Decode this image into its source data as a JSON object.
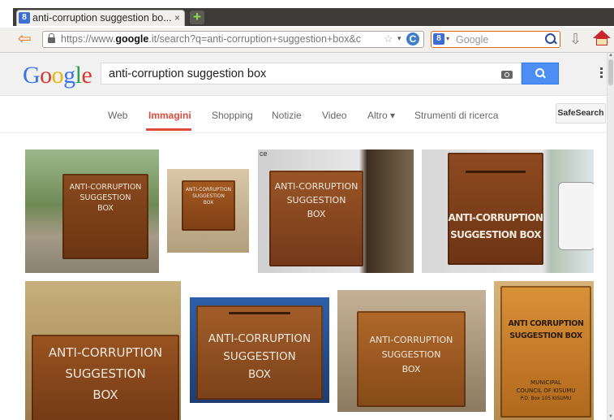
{
  "browser": {
    "tab": {
      "title": "anti-corruption suggestion bo...",
      "close": "×",
      "favicon": "8"
    },
    "new_tab": "+",
    "url": {
      "prefix": "https://www.",
      "domain": "google",
      "rest": ".it/search?q=anti-corruption+suggestion+box&c"
    },
    "search_engine_badge": "8",
    "search_placeholder": "Google",
    "back": "⇦",
    "star": "☆",
    "dropdown": "▾",
    "reload": "C",
    "download": "⇩"
  },
  "google": {
    "logo": [
      "G",
      "o",
      "o",
      "g",
      "l",
      "e"
    ],
    "query": "anti-corruption suggestion box",
    "nav": [
      {
        "label": "Web",
        "active": false
      },
      {
        "label": "Immagini",
        "active": true
      },
      {
        "label": "Shopping",
        "active": false
      },
      {
        "label": "Notizie",
        "active": false
      },
      {
        "label": "Video",
        "active": false
      },
      {
        "label": "Altro ▾",
        "active": false
      },
      {
        "label": "Strumenti di ricerca",
        "active": false
      }
    ],
    "safesearch": "SafeSearch"
  },
  "results": [
    {
      "lines": [
        "ANTI-CORRUPTION",
        "SUGGESTION",
        "BOX"
      ]
    },
    {
      "lines": [
        "ANTI-CORRUPTION",
        "SUGGESTION",
        "BOX"
      ]
    },
    {
      "lines": [
        "ANTI-CORRUPTION",
        "SUGGESTION",
        "BOX"
      ],
      "corner": "ce"
    },
    {
      "lines": [
        "ANTI-CORRUPTION",
        "SUGGESTION BOX"
      ]
    },
    {
      "lines": [
        "ANTI-CORRUPTION",
        "SUGGESTION",
        "BOX"
      ]
    },
    {
      "lines": [
        "ANTI-CORRUPTION",
        "SUGGESTION",
        "BOX"
      ]
    },
    {
      "lines": [
        "ANTI-CORRUPTION",
        "SUGGESTION",
        "BOX"
      ]
    },
    {
      "lines": [
        "ANTI CORRUPTION",
        "SUGGESTION BOX"
      ],
      "extra": [
        "MUNICIPAL",
        "COUNCIL OF KISUMU",
        "P.O. Box 105 KISUMU"
      ]
    }
  ]
}
